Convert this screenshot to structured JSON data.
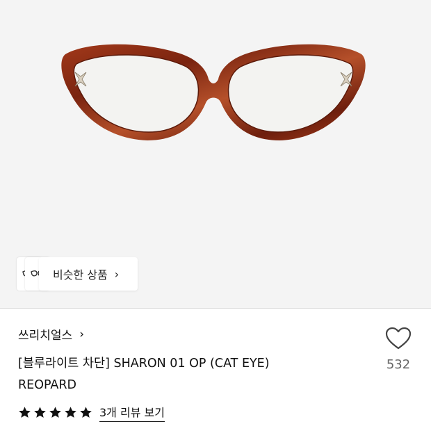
{
  "product_image": {
    "alt_icon": "cat-eye-glasses-image",
    "frame_color": "#8b2e14",
    "background": "#f4f4f4"
  },
  "similar_products": {
    "label": "비슷한 상품",
    "chevron": "›"
  },
  "brand": {
    "name": "쓰리치얼스",
    "chevron": "›"
  },
  "product": {
    "title_line1": "[블루라이트 차단] SHARON 01 OP (CAT EYE)",
    "title_line2": "REOPARD"
  },
  "like": {
    "icon": "heart-icon",
    "count": "532"
  },
  "rating": {
    "stars": 5,
    "review_link": "3개 리뷰 보기"
  }
}
